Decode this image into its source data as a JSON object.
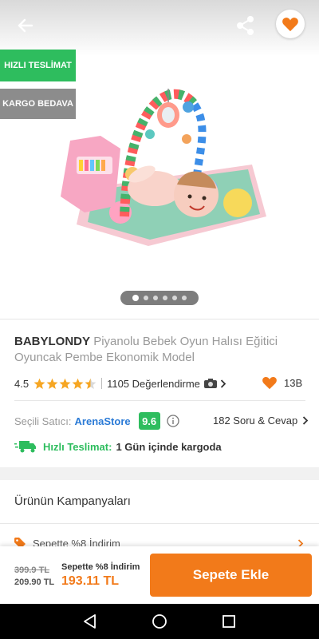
{
  "badges": {
    "fast_delivery": "HIZLI TESLİMAT",
    "free_cargo": "KARGO BEDAVA"
  },
  "gallery": {
    "image_count": 6,
    "active_index": 0
  },
  "product": {
    "brand": "BABYLONDY",
    "name": "Piyanolu Bebek Oyun Halısı Eğitici Oyuncak Pembe Ekonomik Model",
    "rating": "4.5",
    "rating_value": 4.5,
    "reviews": "1105 Değerlendirme",
    "favorites": "13B"
  },
  "seller": {
    "label": "Seçili Satıcı:",
    "name": "ArenaStore",
    "score": "9.6",
    "qa": "182 Soru & Cevap"
  },
  "shipping": {
    "label": "Hızlı Teslimat:",
    "text": "1 Gün içinde kargoda"
  },
  "campaigns": {
    "title": "Ürünün Kampanyaları",
    "items": [
      "Sepette %8 İndirim"
    ]
  },
  "pricing": {
    "old_price": "399.9 TL",
    "discounted_price": "209.90 TL",
    "cart_discount_label": "Sepette %8 İndirim",
    "final_price": "193.11 TL"
  },
  "actions": {
    "add_to_cart": "Sepete Ekle"
  },
  "colors": {
    "accent": "#f27a1a",
    "green": "#2ebd5e",
    "link": "#2a7ad6",
    "star": "#f6a623"
  },
  "icons": {
    "back": "arrow-left-icon",
    "share": "share-icon",
    "favorite": "heart-icon",
    "camera": "camera-icon",
    "info": "info-icon",
    "truck": "truck-icon",
    "tag": "tag-icon",
    "nav_back": "triangle-back-icon",
    "nav_home": "circle-home-icon",
    "nav_recents": "square-recents-icon"
  }
}
